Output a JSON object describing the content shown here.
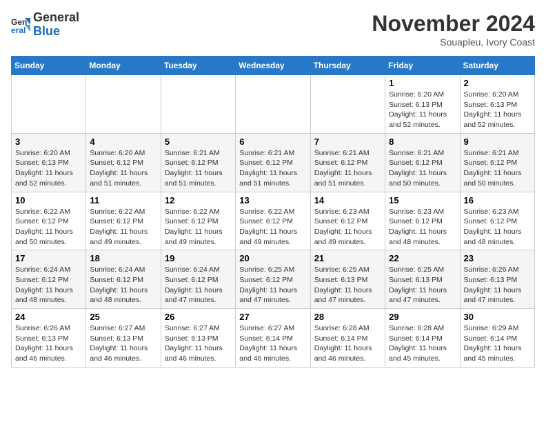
{
  "logo": {
    "general": "General",
    "blue": "Blue"
  },
  "header": {
    "month": "November 2024",
    "location": "Souapleu, Ivory Coast"
  },
  "weekdays": [
    "Sunday",
    "Monday",
    "Tuesday",
    "Wednesday",
    "Thursday",
    "Friday",
    "Saturday"
  ],
  "weeks": [
    [
      {
        "day": "",
        "info": ""
      },
      {
        "day": "",
        "info": ""
      },
      {
        "day": "",
        "info": ""
      },
      {
        "day": "",
        "info": ""
      },
      {
        "day": "",
        "info": ""
      },
      {
        "day": "1",
        "info": "Sunrise: 6:20 AM\nSunset: 6:13 PM\nDaylight: 11 hours and 52 minutes."
      },
      {
        "day": "2",
        "info": "Sunrise: 6:20 AM\nSunset: 6:13 PM\nDaylight: 11 hours and 52 minutes."
      }
    ],
    [
      {
        "day": "3",
        "info": "Sunrise: 6:20 AM\nSunset: 6:13 PM\nDaylight: 11 hours and 52 minutes."
      },
      {
        "day": "4",
        "info": "Sunrise: 6:20 AM\nSunset: 6:12 PM\nDaylight: 11 hours and 51 minutes."
      },
      {
        "day": "5",
        "info": "Sunrise: 6:21 AM\nSunset: 6:12 PM\nDaylight: 11 hours and 51 minutes."
      },
      {
        "day": "6",
        "info": "Sunrise: 6:21 AM\nSunset: 6:12 PM\nDaylight: 11 hours and 51 minutes."
      },
      {
        "day": "7",
        "info": "Sunrise: 6:21 AM\nSunset: 6:12 PM\nDaylight: 11 hours and 51 minutes."
      },
      {
        "day": "8",
        "info": "Sunrise: 6:21 AM\nSunset: 6:12 PM\nDaylight: 11 hours and 50 minutes."
      },
      {
        "day": "9",
        "info": "Sunrise: 6:21 AM\nSunset: 6:12 PM\nDaylight: 11 hours and 50 minutes."
      }
    ],
    [
      {
        "day": "10",
        "info": "Sunrise: 6:22 AM\nSunset: 6:12 PM\nDaylight: 11 hours and 50 minutes."
      },
      {
        "day": "11",
        "info": "Sunrise: 6:22 AM\nSunset: 6:12 PM\nDaylight: 11 hours and 49 minutes."
      },
      {
        "day": "12",
        "info": "Sunrise: 6:22 AM\nSunset: 6:12 PM\nDaylight: 11 hours and 49 minutes."
      },
      {
        "day": "13",
        "info": "Sunrise: 6:22 AM\nSunset: 6:12 PM\nDaylight: 11 hours and 49 minutes."
      },
      {
        "day": "14",
        "info": "Sunrise: 6:23 AM\nSunset: 6:12 PM\nDaylight: 11 hours and 49 minutes."
      },
      {
        "day": "15",
        "info": "Sunrise: 6:23 AM\nSunset: 6:12 PM\nDaylight: 11 hours and 48 minutes."
      },
      {
        "day": "16",
        "info": "Sunrise: 6:23 AM\nSunset: 6:12 PM\nDaylight: 11 hours and 48 minutes."
      }
    ],
    [
      {
        "day": "17",
        "info": "Sunrise: 6:24 AM\nSunset: 6:12 PM\nDaylight: 11 hours and 48 minutes."
      },
      {
        "day": "18",
        "info": "Sunrise: 6:24 AM\nSunset: 6:12 PM\nDaylight: 11 hours and 48 minutes."
      },
      {
        "day": "19",
        "info": "Sunrise: 6:24 AM\nSunset: 6:12 PM\nDaylight: 11 hours and 47 minutes."
      },
      {
        "day": "20",
        "info": "Sunrise: 6:25 AM\nSunset: 6:12 PM\nDaylight: 11 hours and 47 minutes."
      },
      {
        "day": "21",
        "info": "Sunrise: 6:25 AM\nSunset: 6:13 PM\nDaylight: 11 hours and 47 minutes."
      },
      {
        "day": "22",
        "info": "Sunrise: 6:25 AM\nSunset: 6:13 PM\nDaylight: 11 hours and 47 minutes."
      },
      {
        "day": "23",
        "info": "Sunrise: 6:26 AM\nSunset: 6:13 PM\nDaylight: 11 hours and 47 minutes."
      }
    ],
    [
      {
        "day": "24",
        "info": "Sunrise: 6:26 AM\nSunset: 6:13 PM\nDaylight: 11 hours and 46 minutes."
      },
      {
        "day": "25",
        "info": "Sunrise: 6:27 AM\nSunset: 6:13 PM\nDaylight: 11 hours and 46 minutes."
      },
      {
        "day": "26",
        "info": "Sunrise: 6:27 AM\nSunset: 6:13 PM\nDaylight: 11 hours and 46 minutes."
      },
      {
        "day": "27",
        "info": "Sunrise: 6:27 AM\nSunset: 6:14 PM\nDaylight: 11 hours and 46 minutes."
      },
      {
        "day": "28",
        "info": "Sunrise: 6:28 AM\nSunset: 6:14 PM\nDaylight: 11 hours and 46 minutes."
      },
      {
        "day": "29",
        "info": "Sunrise: 6:28 AM\nSunset: 6:14 PM\nDaylight: 11 hours and 45 minutes."
      },
      {
        "day": "30",
        "info": "Sunrise: 6:29 AM\nSunset: 6:14 PM\nDaylight: 11 hours and 45 minutes."
      }
    ]
  ]
}
